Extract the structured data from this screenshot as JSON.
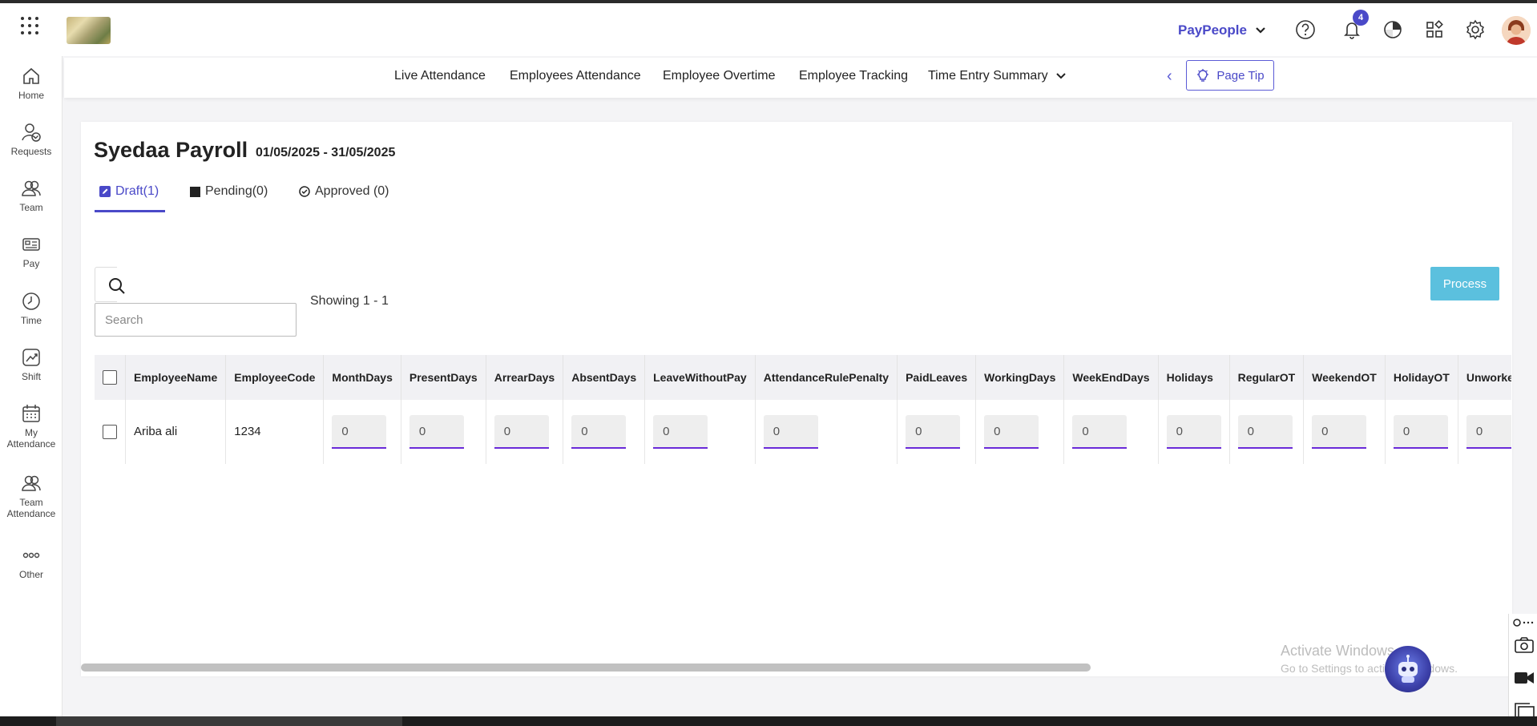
{
  "header": {
    "company_name": "PayPeople",
    "notification_count": "4",
    "accent_color": "#4a49c8"
  },
  "sidebar": {
    "items": [
      {
        "label": "Home",
        "icon": "home-icon"
      },
      {
        "label": "Requests",
        "icon": "requests-icon"
      },
      {
        "label": "Team",
        "icon": "team-icon"
      },
      {
        "label": "Pay",
        "icon": "pay-icon"
      },
      {
        "label": "Time",
        "icon": "clock-icon"
      },
      {
        "label": "Shift",
        "icon": "shift-icon"
      },
      {
        "label": "My Attendance",
        "label_line1": "My",
        "label_line2": "Attendance",
        "icon": "calendar-icon"
      },
      {
        "label": "Team Attendance",
        "label_line1": "Team",
        "label_line2": "Attendance",
        "icon": "team-attendance-icon"
      },
      {
        "label": "Other",
        "icon": "more-icon"
      }
    ]
  },
  "subnav": {
    "items": [
      "Live Attendance",
      "Employees Attendance",
      "Employee Overtime",
      "Employee Tracking",
      "Time Entry Summary"
    ],
    "page_tip_label": "Page Tip"
  },
  "page": {
    "title": "Syedaa Payroll",
    "period": "01/05/2025 - 31/05/2025",
    "tabs": [
      {
        "label": "Draft(1)",
        "icon": "edit-icon",
        "active": true
      },
      {
        "label": "Pending(0)",
        "icon": "square-icon",
        "active": false
      },
      {
        "label": "Approved (0)",
        "icon": "check-circle-icon",
        "active": false
      }
    ],
    "search_placeholder": "Search",
    "showing_text": "Showing 1 - 1",
    "process_label": "Process"
  },
  "table": {
    "columns": [
      "EmployeeName",
      "EmployeeCode",
      "MonthDays",
      "PresentDays",
      "ArrearDays",
      "AbsentDays",
      "LeaveWithoutPay",
      "AttendanceRulePenalty",
      "PaidLeaves",
      "WorkingDays",
      "WeekEndDays",
      "Holidays",
      "RegularOT",
      "WeekendOT",
      "HolidayOT",
      "UnworkedDays"
    ],
    "rows": [
      {
        "employee_name": "Ariba ali",
        "employee_code": "1234",
        "values": [
          "0",
          "0",
          "0",
          "0",
          "0",
          "0",
          "0",
          "0",
          "0",
          "0",
          "0",
          "0",
          "0",
          "0"
        ]
      }
    ]
  },
  "overlay": {
    "watermark_title": "Activate Windows",
    "watermark_subtitle": "Go to Settings to activate Windows."
  }
}
